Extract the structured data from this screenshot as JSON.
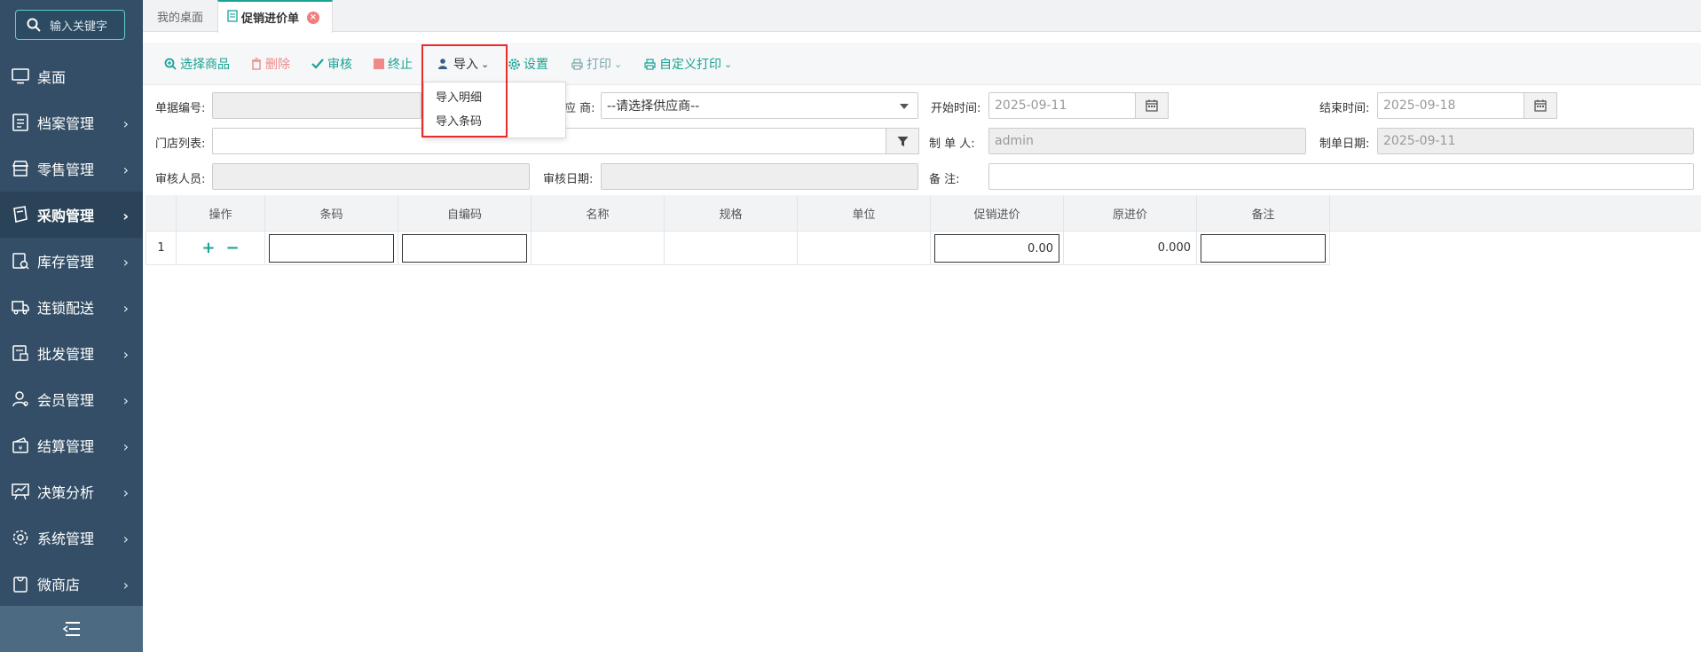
{
  "sidebar": {
    "search_placeholder": "输入关键字",
    "items": [
      {
        "label": "桌面",
        "icon": "monitor-icon",
        "has_arrow": false
      },
      {
        "label": "档案管理",
        "icon": "file-list-icon",
        "has_arrow": true
      },
      {
        "label": "零售管理",
        "icon": "store-icon",
        "has_arrow": true
      },
      {
        "label": "采购管理",
        "icon": "purchase-book-icon",
        "has_arrow": true,
        "active": true
      },
      {
        "label": "库存管理",
        "icon": "inventory-icon",
        "has_arrow": true
      },
      {
        "label": "连锁配送",
        "icon": "truck-icon",
        "has_arrow": true
      },
      {
        "label": "批发管理",
        "icon": "wholesale-icon",
        "has_arrow": true
      },
      {
        "label": "会员管理",
        "icon": "member-icon",
        "has_arrow": true
      },
      {
        "label": "结算管理",
        "icon": "wallet-icon",
        "has_arrow": true
      },
      {
        "label": "决策分析",
        "icon": "chart-board-icon",
        "has_arrow": true
      },
      {
        "label": "系统管理",
        "icon": "gear-icon",
        "has_arrow": true
      },
      {
        "label": "微商店",
        "icon": "shopping-bag-icon",
        "has_arrow": true
      }
    ]
  },
  "tabs": {
    "home": "我的桌面",
    "active": "促销进价单"
  },
  "toolbar": {
    "select_goods": "选择商品",
    "delete": "删除",
    "audit": "审核",
    "stop": "终止",
    "import": "导入",
    "settings": "设置",
    "print": "打印",
    "custom_print": "自定义打印",
    "import_menu": [
      "导入明细",
      "导入条码"
    ]
  },
  "form": {
    "doc_no_label": "单据编号:",
    "supplier_label": "应 商:",
    "supplier_placeholder": "--请选择供应商--",
    "start_label": "开始时间:",
    "start_value": "2025-09-11",
    "end_label": "结束时间:",
    "end_value": "2025-09-18",
    "store_list_label": "门店列表:",
    "maker_label": "制 单 人:",
    "maker_value": "admin",
    "make_date_label": "制单日期:",
    "make_date_value": "2025-09-11",
    "auditor_label": "审核人员:",
    "audit_date_label": "审核日期:",
    "remark_label": "备 注:"
  },
  "grid": {
    "headers": [
      "操作",
      "条码",
      "自编码",
      "名称",
      "规格",
      "单位",
      "促销进价",
      "原进价",
      "备注"
    ],
    "rows": [
      {
        "no": "1",
        "promo_price": "0.00",
        "orig_price": "0.000"
      }
    ]
  },
  "colors": {
    "sidebar_bg": "#334e66",
    "accent": "#19a394",
    "highlight_border": "#e82b2b"
  }
}
